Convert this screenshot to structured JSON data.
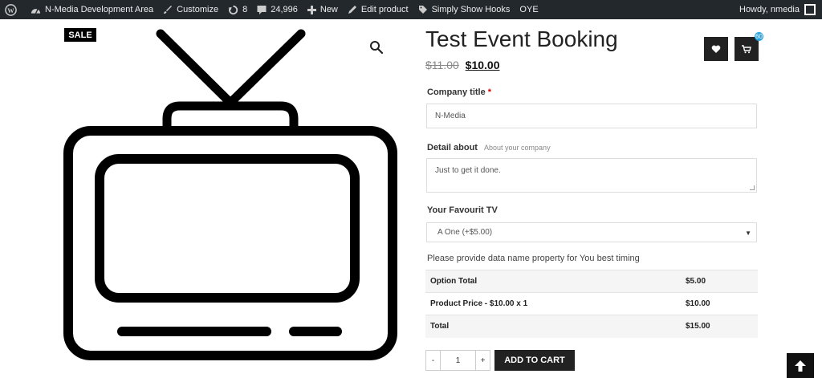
{
  "admin_bar": {
    "site_name": "N-Media Development Area",
    "customize": "Customize",
    "updates_count": "8",
    "comments_count": "24,996",
    "new_label": "New",
    "edit_product": "Edit product",
    "plugin": "Simply Show Hooks",
    "extra": "OYE",
    "greeting": "Howdy, nmedia"
  },
  "gallery": {
    "sale_badge": "SALE"
  },
  "product": {
    "title": "Test Event Booking",
    "old_price": "$11.00",
    "price": "$10.00",
    "cart_count": "60"
  },
  "form": {
    "company": {
      "label": "Company title",
      "required_mark": "*",
      "value": "N-Media"
    },
    "detail": {
      "label": "Detail about",
      "hint": "About your company",
      "value": "Just to get it done."
    },
    "tv": {
      "label": "Your Favourit TV",
      "selected": "A One (+$5.00)"
    },
    "note": "Please provide data name property for You best timing"
  },
  "price_table": {
    "rows": [
      {
        "label": "Option Total",
        "amount": "$5.00"
      },
      {
        "label": "Product Price - $10.00 x 1",
        "amount": "$10.00"
      },
      {
        "label": "Total",
        "amount": "$15.00"
      }
    ]
  },
  "cart": {
    "minus": "-",
    "quantity": "1",
    "plus": "+",
    "add_to_cart": "ADD TO CART"
  },
  "icons": {
    "wordpress": "wordpress-logo-icon",
    "home": "dashboard-icon",
    "customize": "brush-icon",
    "updates": "updates-icon",
    "comments": "comment-icon",
    "new": "plus-icon",
    "edit": "pencil-icon",
    "hooks": "tag-icon",
    "zoom": "search-icon",
    "wishlist": "heart-icon",
    "cart": "cart-icon",
    "to_top": "arrow-up-icon"
  },
  "colors": {
    "admin_bar_bg": "#23282d",
    "button_bg": "#222222",
    "badge_accent": "#2aa4e0",
    "required": "#cc0000"
  }
}
